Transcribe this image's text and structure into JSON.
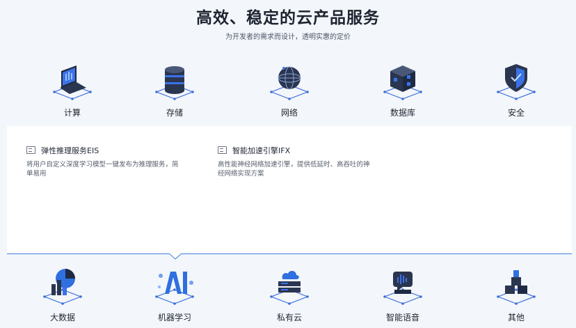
{
  "header": {
    "title": "高效、稳定的云产品服务",
    "subtitle": "为开发者的需求而设计，透明实惠的定价"
  },
  "categories_top": [
    {
      "label": "计算",
      "icon": "laptop-icon"
    },
    {
      "label": "存储",
      "icon": "database-stack-icon"
    },
    {
      "label": "网络",
      "icon": "globe-icon"
    },
    {
      "label": "数据库",
      "icon": "cube-grid-icon"
    },
    {
      "label": "安全",
      "icon": "shield-icon"
    }
  ],
  "panel": {
    "products": [
      {
        "title": "弹性推理服务EIS",
        "desc": "将用户自定义深度学习模型一键发布为推理服务，简单易用",
        "icon": "service-icon"
      },
      {
        "title": "智能加速引擎IFX",
        "desc": "高性能神经网络加速引擎，提供低延时、高吞吐的神经网络实现方案",
        "icon": "service-icon"
      }
    ]
  },
  "categories_bottom": [
    {
      "label": "大数据",
      "icon": "bigdata-chart-icon"
    },
    {
      "label": "机器学习",
      "icon": "ai-icon"
    },
    {
      "label": "私有云",
      "icon": "private-cloud-icon"
    },
    {
      "label": "智能语音",
      "icon": "voice-icon"
    },
    {
      "label": "其他",
      "icon": "blocks-icon"
    }
  ],
  "colors": {
    "accent": "#3d7de0",
    "icon_dark": "#2a3550",
    "icon_blue": "#2f6fe0",
    "background": "#f3f6fa"
  }
}
